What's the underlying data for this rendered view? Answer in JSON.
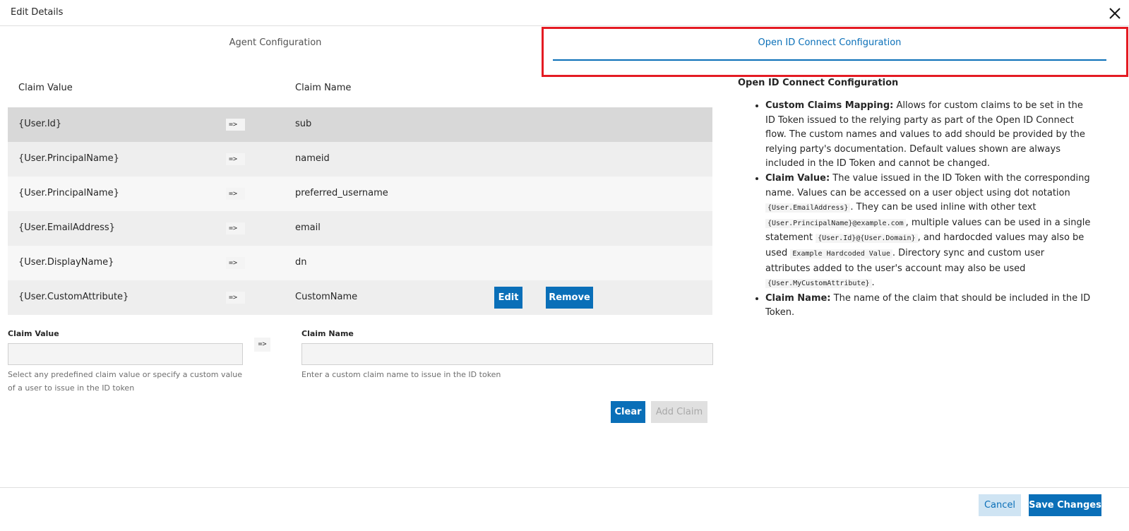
{
  "dialog": {
    "title": "Edit Details",
    "close_icon": "close-icon"
  },
  "tabs": [
    {
      "label": "Agent Configuration",
      "active": false
    },
    {
      "label": "Open ID Connect Configuration",
      "active": true
    }
  ],
  "table": {
    "headers": {
      "claim_value": "Claim Value",
      "claim_name": "Claim Name"
    },
    "arrow": "=>",
    "rows": [
      {
        "value": "{User.Id}",
        "name": "sub"
      },
      {
        "value": "{User.PrincipalName}",
        "name": "nameid"
      },
      {
        "value": "{User.PrincipalName}",
        "name": "preferred_username"
      },
      {
        "value": "{User.EmailAddress}",
        "name": "email"
      },
      {
        "value": "{User.DisplayName}",
        "name": "dn"
      },
      {
        "value": "{User.CustomAttribute}",
        "name": "CustomName",
        "edit_label": "Edit",
        "remove_label": "Remove"
      }
    ]
  },
  "form": {
    "claim_value_label": "Claim Value",
    "claim_value_value": "",
    "claim_value_help": "Select any predefined claim value or specify a custom value of a user to issue in the ID token",
    "arrow": "=>",
    "claim_name_label": "Claim Name",
    "claim_name_value": "",
    "claim_name_help": "Enter a custom claim name to issue in the ID token",
    "clear_label": "Clear",
    "add_claim_label": "Add Claim"
  },
  "info": {
    "title": "Open ID Connect Configuration",
    "custom_claims_term": "Custom Claims Mapping:",
    "custom_claims_text": "Allows for custom claims to be set in the ID Token issued to the relying party as part of the Open ID Connect flow. The custom names and values to add should be provided by the relying party's documentation. Default values shown are always included in the ID Token and cannot be changed.",
    "claim_value_term": "Claim Value:",
    "claim_value_text_1": "The value issued in the ID Token with the corresponding name. Values can be accessed on a user object using dot notation",
    "code_1": "{User.EmailAddress}",
    "claim_value_text_2": ". They can be used inline with other text",
    "code_2": "{User.PrincipalName}@example.com",
    "claim_value_text_3": ", multiple values can be used in a single statement",
    "code_3": "{User.Id}@{User.Domain}",
    "claim_value_text_4": ", and hardocded values may also be used",
    "code_4": "Example Hardcoded Value",
    "claim_value_text_5": ". Directory sync and custom user attributes added to the user's account may also be used",
    "code_5": "{User.MyCustomAttribute}",
    "claim_value_text_6": ".",
    "claim_name_term": "Claim Name:",
    "claim_name_text": "The name of the claim that should be included in the ID Token."
  },
  "footer": {
    "cancel_label": "Cancel",
    "save_label": "Save Changes"
  },
  "colors": {
    "accent": "#0a6fb8",
    "highlight": "#e41b23"
  }
}
